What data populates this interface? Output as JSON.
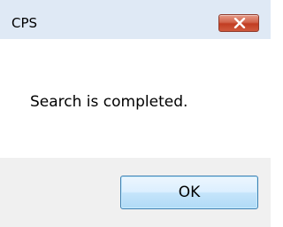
{
  "window": {
    "title": "CPS",
    "close_icon": "close-icon"
  },
  "message": {
    "text": "Search is completed."
  },
  "buttons": {
    "ok_label": "OK"
  },
  "colors": {
    "titlebar": "#dfe9f5",
    "footer": "#f0f0f0",
    "close_button": "#c23d22",
    "ok_button_border": "#3c7fb1"
  }
}
